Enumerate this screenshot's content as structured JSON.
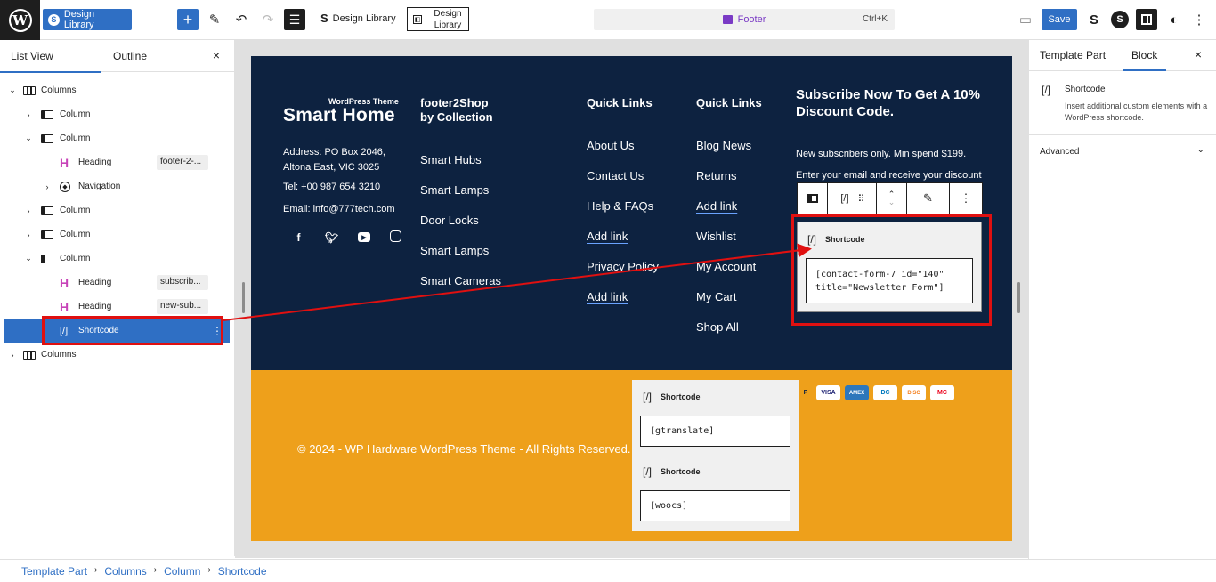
{
  "topbar": {
    "wp_logo": "W",
    "design_library_button": "Design Library",
    "add_button": "+",
    "design_library_link": "Design Library",
    "design_library_box": "Design Library",
    "command": {
      "label": "Footer",
      "shortcut": "Ctrl+K"
    },
    "save_label": "Save"
  },
  "left_panel": {
    "tab_list_view": "List View",
    "tab_outline": "Outline",
    "close": "×",
    "rows": [
      {
        "label": "Columns",
        "tag": ""
      },
      {
        "label": "Column",
        "tag": ""
      },
      {
        "label": "Column",
        "tag": ""
      },
      {
        "label": "Heading",
        "tag": "footer-2-..."
      },
      {
        "label": "Navigation",
        "tag": ""
      },
      {
        "label": "Column",
        "tag": ""
      },
      {
        "label": "Column",
        "tag": ""
      },
      {
        "label": "Column",
        "tag": ""
      },
      {
        "label": "Heading",
        "tag": "subscrib..."
      },
      {
        "label": "Heading",
        "tag": "new-sub..."
      },
      {
        "label": "Shortcode",
        "tag": ""
      },
      {
        "label": "Columns",
        "tag": ""
      }
    ]
  },
  "footer": {
    "brand_tagline": "WordPress Theme",
    "brand_name": "Smart Home",
    "address_line1": "Address: PO Box 2046,",
    "address_line2": "Altona East, VIC 3025",
    "tel": "Tel: +00 987 654 3210",
    "email": "Email: info@777tech.com",
    "col2_heading_line1": "footer2Shop",
    "col2_heading_line2": "by Collection",
    "col2_links": [
      "Smart Hubs",
      "Smart Lamps",
      "Door Locks",
      "Smart Lamps",
      "Smart Cameras"
    ],
    "col3_heading": "Quick Links",
    "col3_links": [
      "About Us",
      "Contact Us",
      "Help & FAQs",
      "Add link",
      "Privacy Policy",
      "Add link"
    ],
    "col4_heading": "Quick Links",
    "col4_links": [
      "Blog News",
      "Returns",
      "Add link",
      "Wishlist",
      "My Account",
      "My Cart",
      "Shop All"
    ],
    "subscribe_heading": "Subscribe Now To Get A 10% Discount Code.",
    "subscribe_note": "New subscribers only. Min spend $199.",
    "subscribe_text": "Enter your email and receive your discount",
    "shortcode_title": "Shortcode",
    "shortcode_value": "[contact-form-7 id=\"140\" title=\"Newsletter Form\"]",
    "gtranslate_title": "Shortcode",
    "gtranslate_value": "[gtranslate]",
    "woocs_title": "Shortcode",
    "woocs_value": "[woocs]",
    "payments": [
      "P",
      "VISA",
      "AMEX",
      "DC",
      "DISC",
      "MC"
    ],
    "copyright": "© 2024 - WP Hardware WordPress Theme - All Rights Reserved."
  },
  "right_panel": {
    "tab_template_part": "Template Part",
    "tab_block": "Block",
    "close": "×",
    "block_icon": "[/]",
    "block_name": "Shortcode",
    "block_desc": "Insert additional custom elements with a WordPress shortcode.",
    "advanced": "Advanced"
  },
  "breadcrumb": [
    "Template Part",
    "Columns",
    "Column",
    "Shortcode"
  ],
  "colors": {
    "accent": "#2f6fc4",
    "footer_dark": "#0d2240",
    "footer_gold": "#eea01b",
    "highlight_red": "#e01010"
  }
}
